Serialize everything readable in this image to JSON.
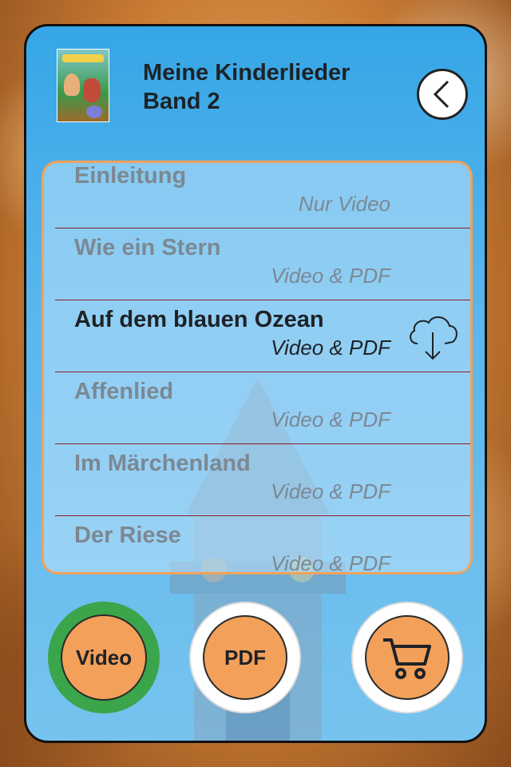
{
  "header": {
    "title": "Meine Kinderlieder Band 2",
    "back_icon": "chevron-left-icon"
  },
  "songs": [
    {
      "title": "Einleitung",
      "type": "Nur Video",
      "active": false
    },
    {
      "title": "Wie ein Stern",
      "type": "Video & PDF",
      "active": false
    },
    {
      "title": "Auf dem blauen Ozean",
      "type": "Video & PDF",
      "active": true,
      "icon": "cloud-download-icon"
    },
    {
      "title": "Affenlied",
      "type": "Video & PDF",
      "active": false
    },
    {
      "title": "Im Märchenland",
      "type": "Video & PDF",
      "active": false
    },
    {
      "title": "Der Riese",
      "type": "Video & PDF",
      "active": false
    }
  ],
  "buttons": {
    "video_label": "Video",
    "pdf_label": "PDF",
    "cart_icon": "shopping-cart-icon"
  },
  "colors": {
    "accent_orange": "#f2a05a",
    "selected_green": "#3aa54a",
    "panel_blue": "#35a6e6"
  }
}
